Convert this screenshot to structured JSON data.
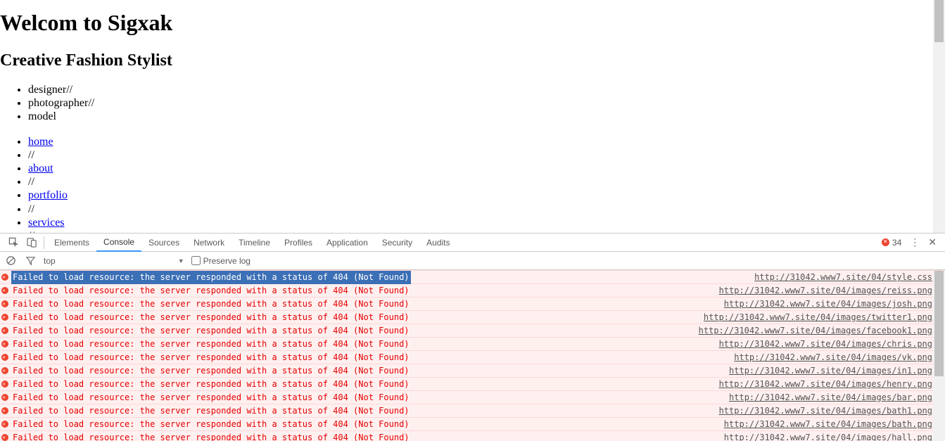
{
  "page": {
    "title": "Welcom to Sigxak",
    "subtitle": "Creative Fashion Stylist",
    "roles": [
      "designer",
      "photographer",
      "model"
    ],
    "roles_suffix": [
      "//",
      "//",
      ""
    ],
    "nav": [
      "home",
      "about",
      "portfolio",
      "services"
    ],
    "nav_sep": "//"
  },
  "devtools": {
    "tabs": [
      "Elements",
      "Console",
      "Sources",
      "Network",
      "Timeline",
      "Profiles",
      "Application",
      "Security",
      "Audits"
    ],
    "active_tab": "Console",
    "error_count": "34",
    "context": "top",
    "filter_tri": "▼",
    "preserve_label": "Preserve log",
    "errors": [
      {
        "msg": "Failed to load resource: the server responded with a status of 404 (Not Found)",
        "src": "http://31042.www7.site/04/style.css"
      },
      {
        "msg": "Failed to load resource: the server responded with a status of 404 (Not Found)",
        "src": "http://31042.www7.site/04/images/reiss.png"
      },
      {
        "msg": "Failed to load resource: the server responded with a status of 404 (Not Found)",
        "src": "http://31042.www7.site/04/images/josh.png"
      },
      {
        "msg": "Failed to load resource: the server responded with a status of 404 (Not Found)",
        "src": "http://31042.www7.site/04/images/twitter1.png"
      },
      {
        "msg": "Failed to load resource: the server responded with a status of 404 (Not Found)",
        "src": "http://31042.www7.site/04/images/facebook1.png"
      },
      {
        "msg": "Failed to load resource: the server responded with a status of 404 (Not Found)",
        "src": "http://31042.www7.site/04/images/chris.png"
      },
      {
        "msg": "Failed to load resource: the server responded with a status of 404 (Not Found)",
        "src": "http://31042.www7.site/04/images/vk.png"
      },
      {
        "msg": "Failed to load resource: the server responded with a status of 404 (Not Found)",
        "src": "http://31042.www7.site/04/images/in1.png"
      },
      {
        "msg": "Failed to load resource: the server responded with a status of 404 (Not Found)",
        "src": "http://31042.www7.site/04/images/henry.png"
      },
      {
        "msg": "Failed to load resource: the server responded with a status of 404 (Not Found)",
        "src": "http://31042.www7.site/04/images/bar.png"
      },
      {
        "msg": "Failed to load resource: the server responded with a status of 404 (Not Found)",
        "src": "http://31042.www7.site/04/images/bath1.png"
      },
      {
        "msg": "Failed to load resource: the server responded with a status of 404 (Not Found)",
        "src": "http://31042.www7.site/04/images/bath.png"
      },
      {
        "msg": "Failed to load resource: the server responded with a status of 404 (Not Found)",
        "src": "http://31042.www7.site/04/images/hall.png"
      }
    ]
  }
}
